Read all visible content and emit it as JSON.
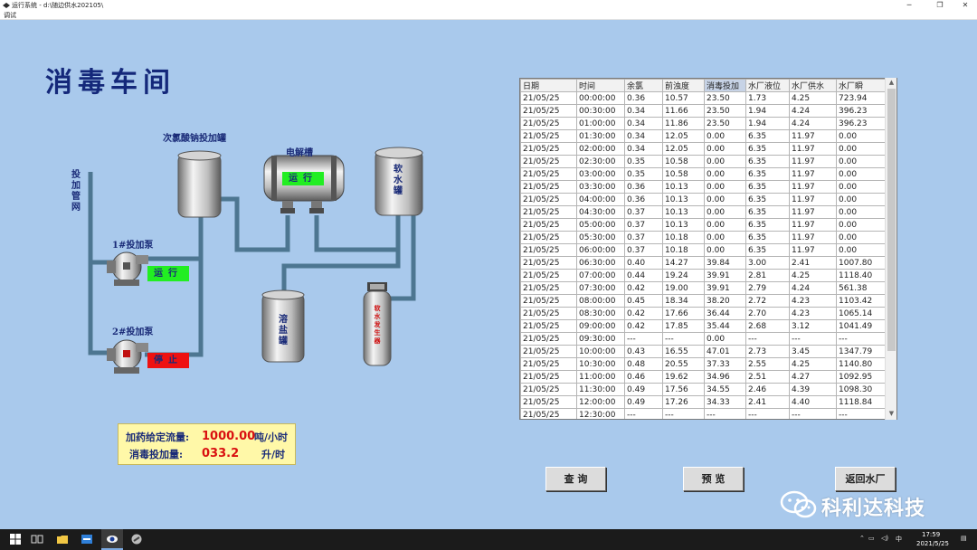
{
  "window": {
    "title": "运行系统 - d:\\随边供水202105\\",
    "menu": "调试"
  },
  "panel": {
    "heading": "消毒车间",
    "labels": {
      "hypochlorite_tank": "次氯酸钠投加罐",
      "electrolytic_cell": "电解槽",
      "soft_water_tank": "软水罐",
      "dosing_pipe": "投加管网",
      "pump1": "1#投加泵",
      "pump2": "2#投加泵",
      "salt_tank": "溶盐罐",
      "softener": "软水发生器"
    },
    "status": {
      "electrolytic": "运行",
      "pump1": "运行",
      "pump2": "停止"
    },
    "colors": {
      "running": "#22ee22",
      "stopped": "#ee1111",
      "pipe": "#4d7691",
      "background": "#a9c9ec"
    },
    "dosing": {
      "flow_label": "加药给定流量:",
      "flow_value": "1000.00",
      "flow_unit": "吨/小时",
      "dose_label": "消毒投加量:",
      "dose_value": "033.2",
      "dose_unit": "升/时"
    }
  },
  "table": {
    "columns": [
      "日期",
      "时间",
      "余氯",
      "前浊度",
      "消毒投加",
      "水厂液位",
      "水厂供水",
      "水厂瞬"
    ],
    "selected_column": 4,
    "rows": [
      [
        "21/05/25",
        "00:00:00",
        "0.36",
        "10.57",
        "23.50",
        "1.73",
        "4.25",
        "723.94"
      ],
      [
        "21/05/25",
        "00:30:00",
        "0.34",
        "11.66",
        "23.50",
        "1.94",
        "4.24",
        "396.23"
      ],
      [
        "21/05/25",
        "01:00:00",
        "0.34",
        "11.86",
        "23.50",
        "1.94",
        "4.24",
        "396.23"
      ],
      [
        "21/05/25",
        "01:30:00",
        "0.34",
        "12.05",
        "0.00",
        "6.35",
        "11.97",
        "0.00"
      ],
      [
        "21/05/25",
        "02:00:00",
        "0.34",
        "12.05",
        "0.00",
        "6.35",
        "11.97",
        "0.00"
      ],
      [
        "21/05/25",
        "02:30:00",
        "0.35",
        "10.58",
        "0.00",
        "6.35",
        "11.97",
        "0.00"
      ],
      [
        "21/05/25",
        "03:00:00",
        "0.35",
        "10.58",
        "0.00",
        "6.35",
        "11.97",
        "0.00"
      ],
      [
        "21/05/25",
        "03:30:00",
        "0.36",
        "10.13",
        "0.00",
        "6.35",
        "11.97",
        "0.00"
      ],
      [
        "21/05/25",
        "04:00:00",
        "0.36",
        "10.13",
        "0.00",
        "6.35",
        "11.97",
        "0.00"
      ],
      [
        "21/05/25",
        "04:30:00",
        "0.37",
        "10.13",
        "0.00",
        "6.35",
        "11.97",
        "0.00"
      ],
      [
        "21/05/25",
        "05:00:00",
        "0.37",
        "10.13",
        "0.00",
        "6.35",
        "11.97",
        "0.00"
      ],
      [
        "21/05/25",
        "05:30:00",
        "0.37",
        "10.18",
        "0.00",
        "6.35",
        "11.97",
        "0.00"
      ],
      [
        "21/05/25",
        "06:00:00",
        "0.37",
        "10.18",
        "0.00",
        "6.35",
        "11.97",
        "0.00"
      ],
      [
        "21/05/25",
        "06:30:00",
        "0.40",
        "14.27",
        "39.84",
        "3.00",
        "2.41",
        "1007.80"
      ],
      [
        "21/05/25",
        "07:00:00",
        "0.44",
        "19.24",
        "39.91",
        "2.81",
        "4.25",
        "1118.40"
      ],
      [
        "21/05/25",
        "07:30:00",
        "0.42",
        "19.00",
        "39.91",
        "2.79",
        "4.24",
        "561.38"
      ],
      [
        "21/05/25",
        "08:00:00",
        "0.45",
        "18.34",
        "38.20",
        "2.72",
        "4.23",
        "1103.42"
      ],
      [
        "21/05/25",
        "08:30:00",
        "0.42",
        "17.66",
        "36.44",
        "2.70",
        "4.23",
        "1065.14"
      ],
      [
        "21/05/25",
        "09:00:00",
        "0.42",
        "17.85",
        "35.44",
        "2.68",
        "3.12",
        "1041.49"
      ],
      [
        "21/05/25",
        "09:30:00",
        "---",
        "---",
        "0.00",
        "---",
        "---",
        "---"
      ],
      [
        "21/05/25",
        "10:00:00",
        "0.43",
        "16.55",
        "47.01",
        "2.73",
        "3.45",
        "1347.79"
      ],
      [
        "21/05/25",
        "10:30:00",
        "0.48",
        "20.55",
        "37.33",
        "2.55",
        "4.25",
        "1140.80"
      ],
      [
        "21/05/25",
        "11:00:00",
        "0.46",
        "19.62",
        "34.96",
        "2.51",
        "4.27",
        "1092.95"
      ],
      [
        "21/05/25",
        "11:30:00",
        "0.49",
        "17.56",
        "34.55",
        "2.46",
        "4.39",
        "1098.30"
      ],
      [
        "21/05/25",
        "12:00:00",
        "0.49",
        "17.26",
        "34.33",
        "2.41",
        "4.40",
        "1118.84"
      ],
      [
        "21/05/25",
        "12:30:00",
        "---",
        "---",
        "---",
        "---",
        "---",
        "---"
      ]
    ]
  },
  "buttons": {
    "query": "查 询",
    "preview": "预 览",
    "return": "返回水厂"
  },
  "watermark": "科利达科技",
  "taskbar": {
    "ime": "中",
    "time": "17:59",
    "date": "2021/5/25"
  }
}
